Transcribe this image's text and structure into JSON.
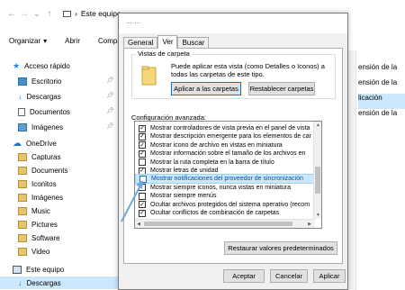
{
  "explorer": {
    "path_root": "Este equipo",
    "ribbon": {
      "organize": "Organizar",
      "open": "Abrir",
      "share_partial": "Compa"
    },
    "sidebar": {
      "quick_access": "Acceso rápido",
      "quick_items": [
        "Escritorio",
        "Descargas",
        "Documentos",
        "Imágenes"
      ],
      "onedrive": "OneDrive",
      "onedrive_items": [
        "Capturas",
        "Documents",
        "Iconitos",
        "Imágenes",
        "Music",
        "Pictures",
        "Software",
        "Video"
      ],
      "this_pc": "Este equipo",
      "this_pc_items": [
        "Descargas"
      ]
    },
    "right_column": [
      "ensión de la",
      "ensión de la",
      "licación",
      "ensión de la"
    ]
  },
  "dialog": {
    "title": "…….",
    "tabs": [
      "General",
      "Ver",
      "Buscar"
    ],
    "active_tab": "Ver",
    "folder_views": {
      "label": "Vistas de carpeta",
      "description": "Puede aplicar esta vista (como Detalles o Iconos) a todas las carpetas de este tipo.",
      "apply_button": "Aplicar a las carpetas",
      "reset_button": "Restablecer carpetas"
    },
    "advanced_label": "Configuración avanzada:",
    "advanced_items": [
      {
        "label": "Mostrar controladores de vista previa en el panel de vista",
        "checked": true
      },
      {
        "label": "Mostrar descripción emergente para los elementos de car",
        "checked": true
      },
      {
        "label": "Mostrar icono de archivo en vistas en miniatura",
        "checked": true
      },
      {
        "label": "Mostrar información sobre el tamaño de los archivos en",
        "checked": true
      },
      {
        "label": "Mostrar la ruta completa en la barra de título",
        "checked": false
      },
      {
        "label": "Mostrar letras de unidad",
        "checked": true
      },
      {
        "label": "Mostrar notificaciones del proveedor de sincronización",
        "checked": false
      },
      {
        "label": "Mostrar siempre iconos, nunca vistas en miniatura",
        "checked": false
      },
      {
        "label": "Mostrar siempre menús",
        "checked": false
      },
      {
        "label": "Ocultar archivos protegidos del sistema operativo (recom",
        "checked": true
      },
      {
        "label": "Ocultar conflictos de combinación de carpetas",
        "checked": true
      }
    ],
    "selected_index": 6,
    "restore_button": "Restaurar valores predeterminados",
    "ok_button": "Aceptar",
    "cancel_button": "Cancelar",
    "apply_button": "Aplicar"
  },
  "colors": {
    "selection": "#cce8ff",
    "accent": "#0078d7",
    "annotation_arrow": "#6fa8dc"
  }
}
